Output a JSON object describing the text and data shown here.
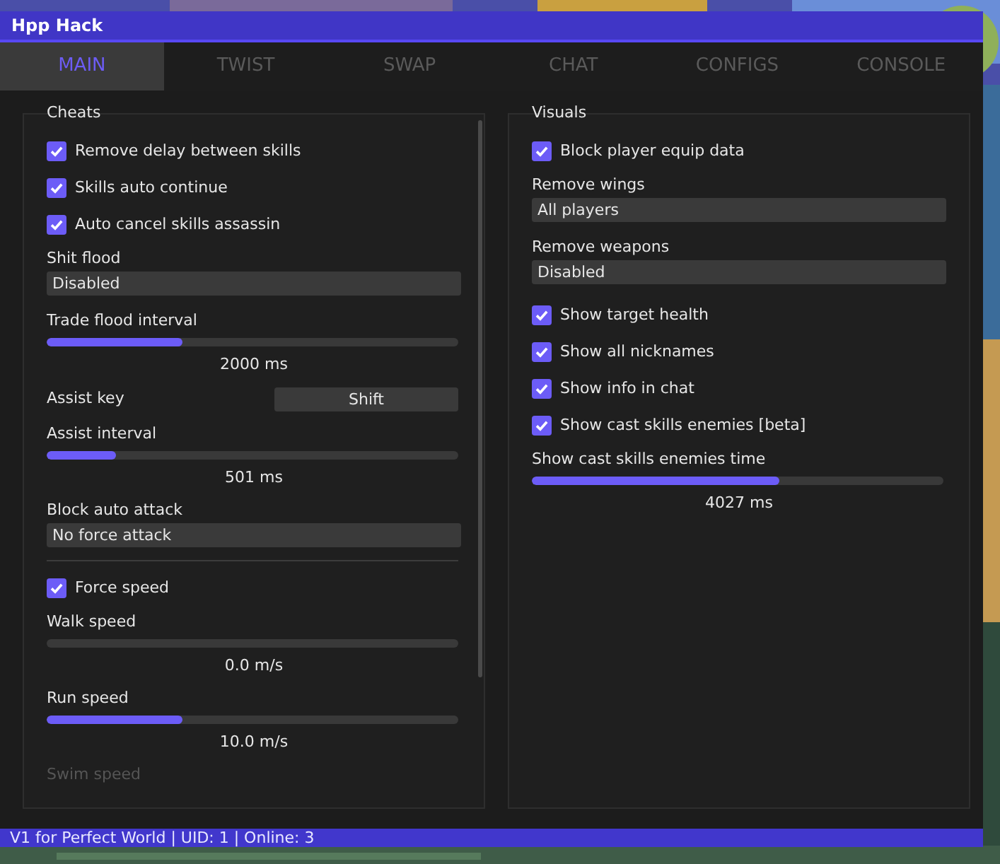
{
  "window": {
    "title": "Hpp Hack"
  },
  "tabs": [
    {
      "label": "MAIN",
      "selected": true
    },
    {
      "label": "TWIST",
      "selected": false
    },
    {
      "label": "SWAP",
      "selected": false
    },
    {
      "label": "CHAT",
      "selected": false
    },
    {
      "label": "CONFIGS",
      "selected": false
    },
    {
      "label": "CONSOLE",
      "selected": false
    }
  ],
  "panels": [
    {
      "title": "Cheats",
      "scrollable": true,
      "items": [
        {
          "kind": "checkbox",
          "label": "Remove delay between skills",
          "checked": true
        },
        {
          "kind": "checkbox",
          "label": "Skills auto continue",
          "checked": true
        },
        {
          "kind": "checkbox",
          "label": "Auto cancel skills assassin",
          "checked": true
        },
        {
          "kind": "combo",
          "label": "Shit flood",
          "value": "Disabled"
        },
        {
          "kind": "slider",
          "label": "Trade flood interval",
          "level": 0.33,
          "reading": "2000 ms"
        },
        {
          "kind": "keybind",
          "label": "Assist key",
          "value": "Shift"
        },
        {
          "kind": "slider",
          "label": "Assist interval",
          "level": 0.17,
          "reading": "501 ms"
        },
        {
          "kind": "combo",
          "label": "Block auto attack",
          "value": "No force attack"
        },
        {
          "kind": "separator"
        },
        {
          "kind": "checkbox",
          "label": "Force speed",
          "checked": true
        },
        {
          "kind": "slider",
          "label": "Walk speed",
          "level": 0,
          "reading": "0.0 m/s"
        },
        {
          "kind": "slider",
          "label": "Run speed",
          "level": 0.33,
          "reading": "10.0 m/s"
        },
        {
          "kind": "caption",
          "label": "Swim speed"
        }
      ]
    },
    {
      "title": "Visuals",
      "scrollable": false,
      "items": [
        {
          "kind": "checkbox",
          "label": "Block player equip data",
          "checked": true
        },
        {
          "kind": "combo",
          "label": "Remove wings",
          "value": "All players"
        },
        {
          "kind": "combo",
          "label": "Remove weapons",
          "value": "Disabled"
        },
        {
          "kind": "checkbox",
          "label": "Show target health",
          "checked": true
        },
        {
          "kind": "checkbox",
          "label": "Show all nicknames",
          "checked": true
        },
        {
          "kind": "checkbox",
          "label": "Show info in chat",
          "checked": true
        },
        {
          "kind": "checkbox",
          "label": "Show cast skills enemies [beta]",
          "checked": true
        },
        {
          "kind": "slider",
          "label": "Show cast skills enemies time",
          "level": 0.6,
          "reading": "4027 ms"
        }
      ]
    }
  ],
  "status_bar": "V1 for Perfect World | UID: 1 | Online: 3"
}
